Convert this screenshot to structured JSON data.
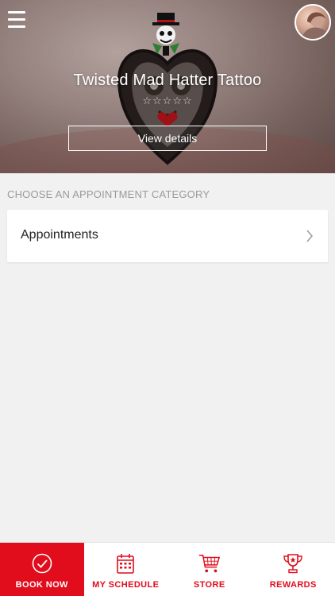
{
  "header": {
    "shop_name": "Twisted Mad Hatter Tattoo",
    "rating_stars": "☆☆☆☆☆",
    "view_details_label": "View details"
  },
  "main": {
    "section_title": "CHOOSE AN APPOINTMENT CATEGORY",
    "categories": [
      {
        "label": "Appointments"
      }
    ]
  },
  "tabbar": {
    "tabs": [
      {
        "label": "BOOK NOW",
        "icon": "check-circle-icon",
        "active": true
      },
      {
        "label": "MY SCHEDULE",
        "icon": "calendar-icon",
        "active": false
      },
      {
        "label": "STORE",
        "icon": "shopping-cart-icon",
        "active": false
      },
      {
        "label": "REWARDS",
        "icon": "trophy-icon",
        "active": false
      }
    ]
  },
  "colors": {
    "accent": "#e10c1c",
    "background": "#f1f1f1",
    "card": "#ffffff",
    "section_label": "#9a9a9a"
  }
}
